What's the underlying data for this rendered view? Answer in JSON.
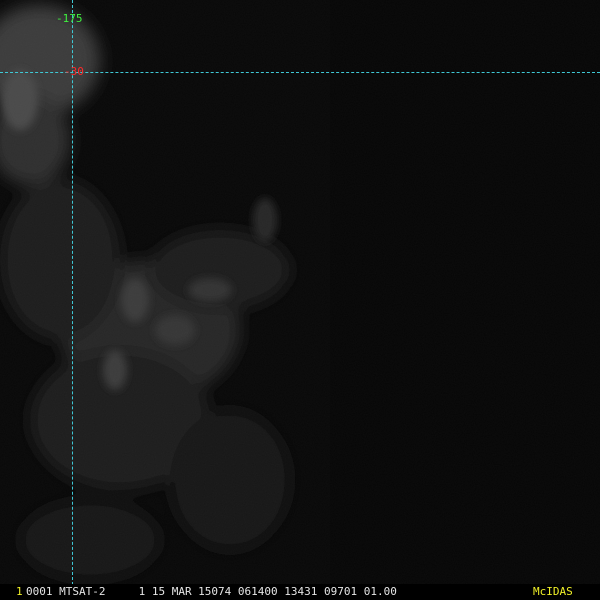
{
  "image": {
    "longitude_label": "-175",
    "latitude_label": "-30",
    "grid_line_color": "#3fc9d6",
    "longitude_label_color": "#3ff03f",
    "latitude_label_color": "#ff2a2a"
  },
  "status_bar": {
    "frame_number": "1",
    "text": "0001 MTSAT-2     1 15 MAR 15074 061400 13431 09701 01.00",
    "brand": "McIDAS",
    "highlight_color": "#f0f028"
  }
}
